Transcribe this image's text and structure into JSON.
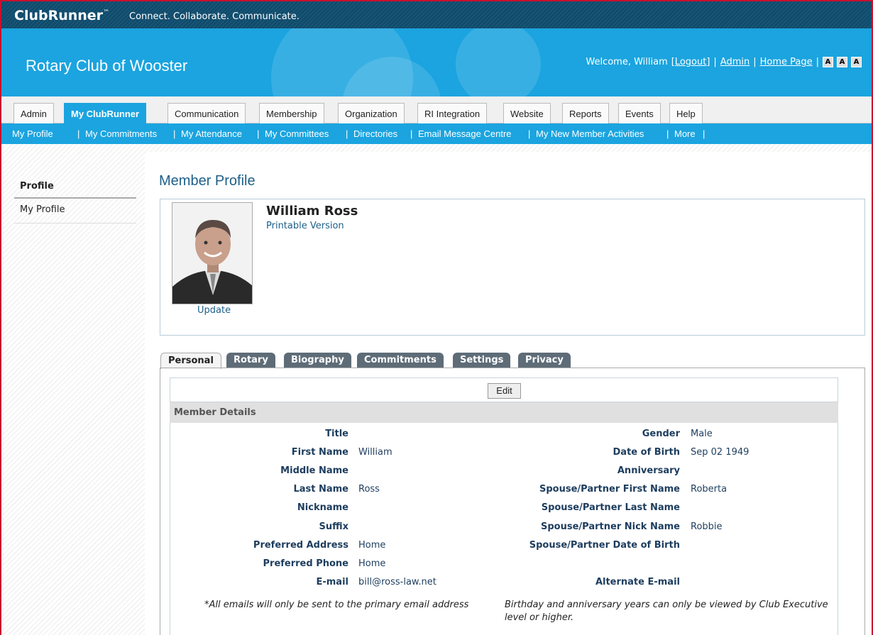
{
  "header": {
    "brand": "ClubRunner",
    "trademark": "™",
    "tagline": "Connect. Collaborate. Communicate."
  },
  "banner": {
    "club_name": "Rotary Club of Wooster",
    "welcome": "Welcome, William",
    "logout": "[Logout]",
    "separator": "|",
    "admin": "Admin",
    "home_page": "Home Page",
    "font_sizes": [
      "A",
      "A",
      "A"
    ]
  },
  "tabs": [
    "Admin",
    "My ClubRunner",
    "Communication",
    "Membership",
    "Organization",
    "RI Integration",
    "Website",
    "Reports",
    "Events",
    "Help"
  ],
  "active_tab": "My ClubRunner",
  "subnav": [
    "My Profile",
    "My Commitments",
    "My Attendance",
    "My Committees",
    "Directories",
    "Email Message Centre",
    "My New Member Activities",
    "More"
  ],
  "sidebar": {
    "heading": "Profile",
    "items": [
      "My Profile"
    ]
  },
  "page": {
    "title": "Member Profile",
    "member_name": "William Ross",
    "printable": "Printable Version",
    "update": "Update"
  },
  "profile_tabs": [
    "Personal",
    "Rotary",
    "Biography",
    "Commitments",
    "Settings",
    "Privacy"
  ],
  "edit_label": "Edit",
  "section_title": "Member Details",
  "left_fields": [
    {
      "label": "Title",
      "value": ""
    },
    {
      "label": "First Name",
      "value": "William"
    },
    {
      "label": "Middle Name",
      "value": ""
    },
    {
      "label": "Last Name",
      "value": "Ross"
    },
    {
      "label": "Nickname",
      "value": ""
    },
    {
      "label": "Suffix",
      "value": ""
    },
    {
      "label": "Preferred Address",
      "value": "Home"
    },
    {
      "label": "Preferred Phone",
      "value": "Home"
    },
    {
      "label": "E-mail",
      "value": "bill@ross-law.net"
    }
  ],
  "right_fields": [
    {
      "label": "Gender",
      "value": "Male"
    },
    {
      "label": "Date of Birth",
      "value": "Sep 02 1949"
    },
    {
      "label": "Anniversary",
      "value": ""
    },
    {
      "label": "Spouse/Partner First Name",
      "value": "Roberta"
    },
    {
      "label": "Spouse/Partner Last Name",
      "value": ""
    },
    {
      "label": "Spouse/Partner Nick Name",
      "value": "Robbie"
    },
    {
      "label": "Spouse/Partner Date of Birth",
      "value": ""
    },
    {
      "label": "",
      "value": ""
    },
    {
      "label": "Alternate E-mail",
      "value": ""
    }
  ],
  "notes": {
    "email": "*All emails will only be sent to the primary email address",
    "birthday_line1": "Birthday and anniversary years can only be viewed by Club Executive",
    "birthday_line2": "level or higher."
  },
  "colors": {
    "banner": "#1ba4df",
    "topbar": "#0d4a6b",
    "link": "#1d5f8a",
    "label": "#1d3d5e"
  }
}
